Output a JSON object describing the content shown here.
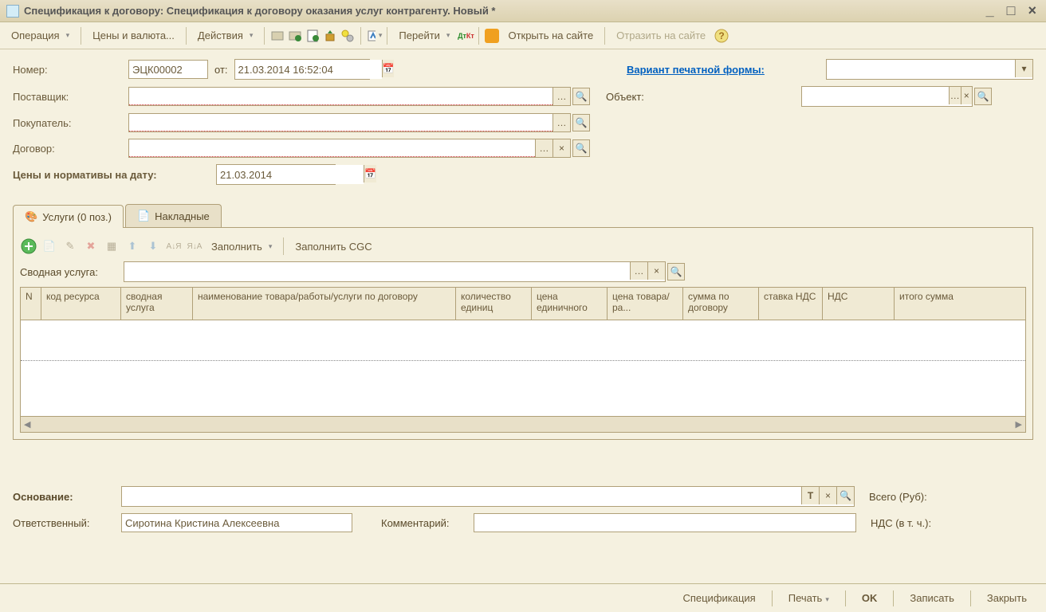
{
  "title": "Спецификация к договору: Спецификация к договору оказания услуг контрагенту. Новый *",
  "toolbar": {
    "operation": "Операция",
    "prices_currency": "Цены и валюта...",
    "actions": "Действия",
    "goto": "Перейти",
    "dtkt": "Дт Кт",
    "open_site": "Открыть на сайте",
    "reflect_site": "Отразить на сайте"
  },
  "form": {
    "number_label": "Номер:",
    "number_value": "ЭЦК00002",
    "from_label": "от:",
    "date_value": "21.03.2014 16:52:04",
    "supplier_label": "Поставщик:",
    "buyer_label": "Покупатель:",
    "contract_label": "Договор:",
    "prices_date_label": "Цены и нормативы на дату:",
    "prices_date_value": "21.03.2014",
    "print_variant_label": "Вариант печатной формы:",
    "object_label": "Объект:"
  },
  "tabs": {
    "services": "Услуги (0 поз.)",
    "invoices": "Накладные"
  },
  "services": {
    "fill": "Заполнить",
    "fill_cgc": "Заполнить CGC",
    "summary_label": "Сводная услуга:",
    "columns": {
      "n": "N",
      "resource_code": "код ресурса",
      "summary_service": "сводная услуга",
      "name": "наименование товара/работы/услуги по договору",
      "qty": "количество единиц",
      "unit_price": "цена единичного",
      "goods_price": "цена товара/ра...",
      "contract_sum": "сумма по договору",
      "vat_rate": "ставка НДС",
      "vat": "НДС",
      "total": "итого сумма"
    }
  },
  "footer": {
    "basis_label": "Основание:",
    "responsible_label": "Ответственный:",
    "responsible_value": "Сиротина Кристина Алексеевна",
    "comment_label": "Комментарий:",
    "total_label": "Всего (Руб):",
    "vat_label": "НДС (в т. ч.):"
  },
  "bottom": {
    "spec": "Спецификация",
    "print": "Печать",
    "ok": "OK",
    "save": "Записать",
    "close": "Закрыть"
  }
}
